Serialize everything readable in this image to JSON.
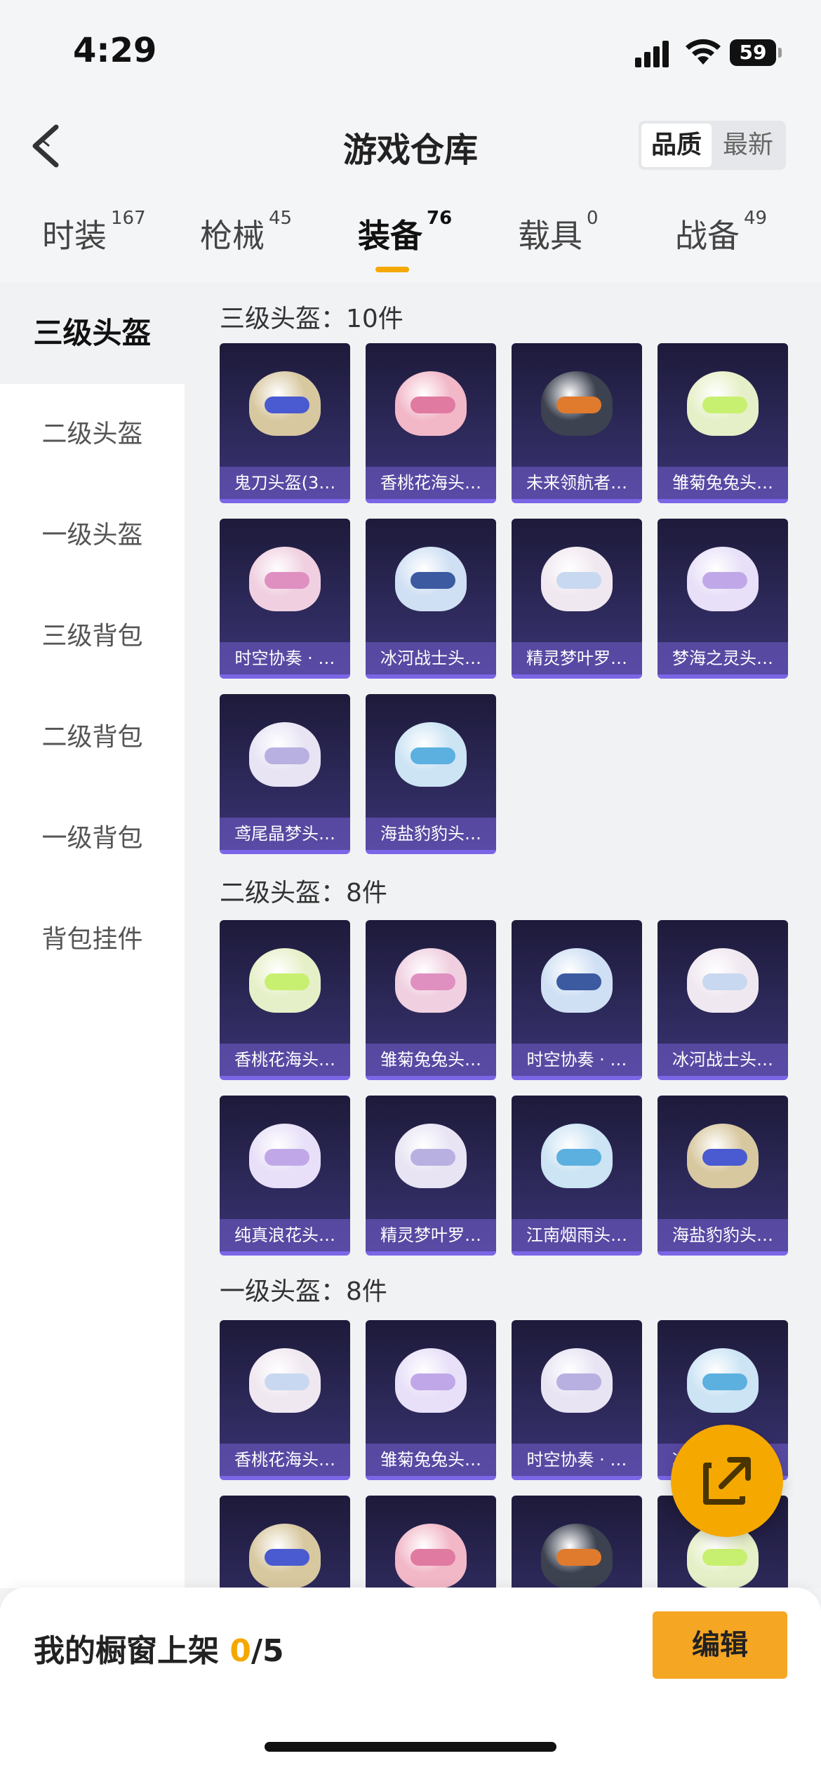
{
  "status_bar": {
    "time": "4:29",
    "battery": "59"
  },
  "header": {
    "title": "游戏仓库",
    "sort_options": [
      "品质",
      "最新"
    ]
  },
  "tabs": [
    {
      "label": "时装",
      "count": "167"
    },
    {
      "label": "枪械",
      "count": "45"
    },
    {
      "label": "装备",
      "count": "76"
    },
    {
      "label": "载具",
      "count": "0"
    },
    {
      "label": "战备",
      "count": "49"
    }
  ],
  "sidebar": {
    "items": [
      "三级头盔",
      "二级头盔",
      "一级头盔",
      "三级背包",
      "二级背包",
      "一级背包",
      "背包挂件"
    ]
  },
  "sections": [
    {
      "title": "三级头盔：10件",
      "items": [
        "鬼刀头盔(3…",
        "香桃花海头…",
        "未来领航者…",
        "雏菊兔兔头…",
        "时空协奏 · …",
        "冰河战士头…",
        "精灵梦叶罗…",
        "梦海之灵头…",
        "鸢尾晶梦头…",
        "海盐豹豹头…"
      ]
    },
    {
      "title": "二级头盔：8件",
      "items": [
        "香桃花海头…",
        "雏菊兔兔头…",
        "时空协奏 · …",
        "冰河战士头…",
        "纯真浪花头…",
        "精灵梦叶罗…",
        "江南烟雨头…",
        "海盐豹豹头…"
      ]
    },
    {
      "title": "一级头盔：8件",
      "items": [
        "香桃花海头…",
        "雏菊兔兔头…",
        "时空协奏 · …",
        "冰河战士头…",
        "",
        "",
        "",
        ""
      ]
    }
  ],
  "bottom_bar": {
    "label": "我的橱窗上架",
    "current": "0",
    "total": "/5",
    "edit_label": "编辑"
  },
  "colors": {
    "accent": "#f5a800",
    "card_bg": "#2e2a5c"
  }
}
